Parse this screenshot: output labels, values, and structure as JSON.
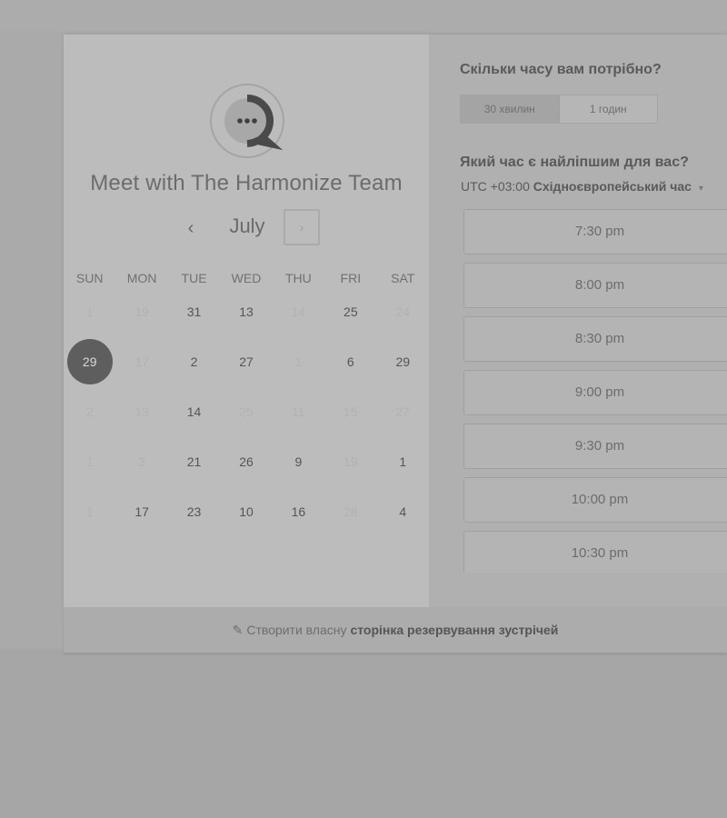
{
  "header": {
    "title": "Meet with The Harmonize Team",
    "month": "July",
    "prev_icon": "‹",
    "next_icon": "›"
  },
  "weekdays": [
    "SUN",
    "MON",
    "TUE",
    "WED",
    "THU",
    "FRI",
    "SAT"
  ],
  "calendar_rows": [
    [
      {
        "d": "1",
        "s": "disabled"
      },
      {
        "d": "19",
        "s": "disabled"
      },
      {
        "d": "31",
        "s": "active"
      },
      {
        "d": "13",
        "s": "active"
      },
      {
        "d": "14",
        "s": "disabled"
      },
      {
        "d": "25",
        "s": "active"
      },
      {
        "d": "24",
        "s": "disabled"
      }
    ],
    [
      {
        "d": "29",
        "s": "selected"
      },
      {
        "d": "17",
        "s": "disabled"
      },
      {
        "d": "2",
        "s": "active"
      },
      {
        "d": "27",
        "s": "active"
      },
      {
        "d": "1",
        "s": "disabled"
      },
      {
        "d": "6",
        "s": "active"
      },
      {
        "d": "29",
        "s": "active"
      }
    ],
    [
      {
        "d": "2",
        "s": "disabled"
      },
      {
        "d": "13",
        "s": "disabled"
      },
      {
        "d": "14",
        "s": "active"
      },
      {
        "d": "25",
        "s": "disabled"
      },
      {
        "d": "11",
        "s": "disabled"
      },
      {
        "d": "15",
        "s": "disabled"
      },
      {
        "d": "27",
        "s": "disabled"
      }
    ],
    [
      {
        "d": "1",
        "s": "disabled"
      },
      {
        "d": "3",
        "s": "disabled"
      },
      {
        "d": "21",
        "s": "active"
      },
      {
        "d": "26",
        "s": "active"
      },
      {
        "d": "9",
        "s": "active"
      },
      {
        "d": "19",
        "s": "disabled"
      },
      {
        "d": "1",
        "s": "active"
      }
    ],
    [
      {
        "d": "1",
        "s": "disabled"
      },
      {
        "d": "17",
        "s": "active"
      },
      {
        "d": "23",
        "s": "active"
      },
      {
        "d": "10",
        "s": "active"
      },
      {
        "d": "16",
        "s": "active"
      },
      {
        "d": "28",
        "s": "disabled"
      },
      {
        "d": "4",
        "s": "active"
      }
    ]
  ],
  "duration": {
    "question": "Скільки часу вам потрібно?",
    "options": [
      "30 хвилин",
      "1 годин"
    ],
    "selected_index": 0
  },
  "time": {
    "question": "Який час є найліпшим для вас?",
    "timezone_offset": "UTC +03:00",
    "timezone_name": "Східноєвропейський час",
    "caret": "▾",
    "slots": [
      "7:30 pm",
      "8:00 pm",
      "8:30 pm",
      "9:00 pm",
      "9:30 pm",
      "10:00 pm",
      "10:30 pm"
    ]
  },
  "footer": {
    "icon": "✎",
    "text": "Створити власну",
    "bold_text": "сторінка резервування зустрічей"
  },
  "colors": {
    "selected_day_bg": "#5e5e5e",
    "background": "#a6a6a6"
  }
}
